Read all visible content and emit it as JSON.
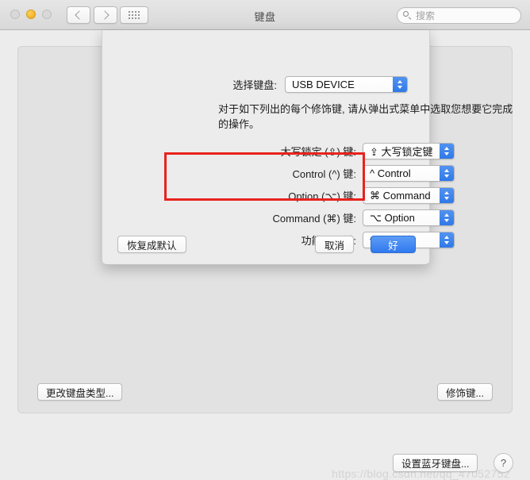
{
  "window": {
    "title": "键盘",
    "traffic_lights": [
      "close",
      "minimize",
      "zoom"
    ],
    "nav_back": "‹",
    "nav_forward": "›"
  },
  "search": {
    "placeholder": "搜索"
  },
  "panel_buttons": {
    "change_keyboard_type": "更改键盘类型...",
    "modifier_keys": "修饰键...",
    "setup_bluetooth_keyboard": "设置蓝牙键盘...",
    "help": "?"
  },
  "sheet": {
    "select_keyboard_label": "选择键盘:",
    "select_keyboard_value": "USB DEVICE",
    "intro": "对于如下列出的每个修饰键, 请从弹出式菜单中选取您想要它完成的操作。",
    "rows": [
      {
        "label": "大写锁定 (⇪) 键:",
        "value": "⇪ 大写锁定键",
        "highlighted": false
      },
      {
        "label": "Control (^) 键:",
        "value": "^ Control",
        "highlighted": false
      },
      {
        "label": "Option (⌥) 键:",
        "value": "⌘ Command",
        "highlighted": true
      },
      {
        "label": "Command (⌘) 键:",
        "value": "⌥ Option",
        "highlighted": true
      },
      {
        "label": "功能 (fn) 键:",
        "value": "fn 功能键",
        "highlighted": false
      }
    ],
    "restore_defaults": "恢复成默认",
    "cancel": "取消",
    "ok": "好"
  },
  "annotation": {
    "highlight_color": "#e8231d"
  },
  "watermark": "https://blog.csdn.net/qq_47052752"
}
